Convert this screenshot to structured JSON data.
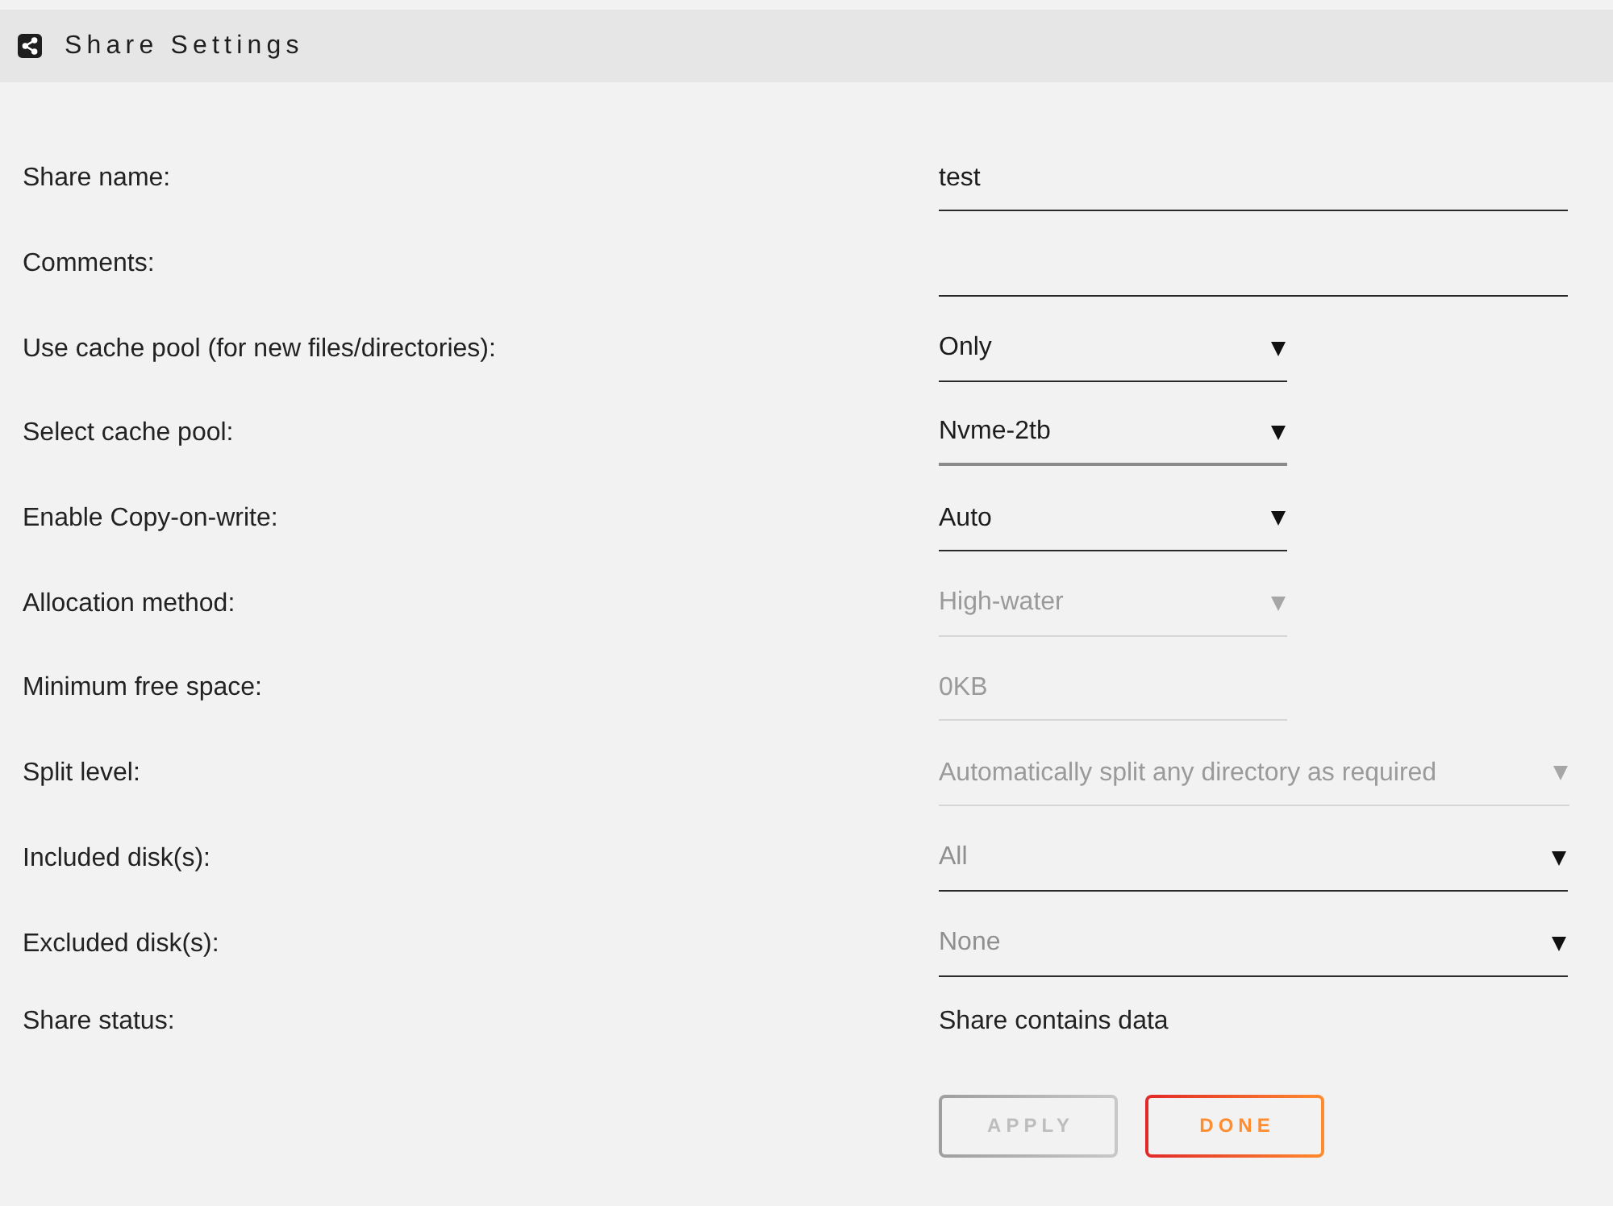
{
  "header": {
    "title": "Share Settings"
  },
  "fields": [
    {
      "label": "Share name:",
      "kind": "text",
      "value": "test",
      "disabled": false,
      "focused": false
    },
    {
      "label": "Comments:",
      "kind": "text",
      "disabled": false,
      "focused": false
    },
    {
      "label": "Use cache pool (for new files/directories):",
      "kind": "select",
      "value": "Only",
      "disabled": false,
      "focused": false
    },
    {
      "label": "Select cache pool:",
      "kind": "select",
      "value": "Nvme-2tb",
      "disabled": false,
      "focused": true
    },
    {
      "label": "Enable Copy-on-write:",
      "kind": "select",
      "value": "Auto",
      "disabled": false,
      "focused": false
    },
    {
      "label": "Allocation method:",
      "kind": "select",
      "value": "High-water",
      "disabled": true,
      "focused": false
    },
    {
      "label": "Minimum free space:",
      "kind": "number",
      "value": "0KB",
      "disabled": true,
      "focused": false
    },
    {
      "label": "Split level:",
      "kind": "select",
      "value": "Automatically split any directory as required",
      "disabled": true,
      "focused": false
    },
    {
      "label": "Included disk(s):",
      "kind": "checklist",
      "placeholder": "All",
      "disabled": false,
      "focused": false
    },
    {
      "label": "Excluded disk(s):",
      "kind": "checklist",
      "placeholder": "None",
      "disabled": false,
      "focused": false
    }
  ],
  "share_status": {
    "label": "Share status:",
    "value": "Share contains data"
  },
  "buttons": [
    {
      "label": "APPLY",
      "disabled": true
    },
    {
      "label": "DONE",
      "disabled": false
    }
  ]
}
